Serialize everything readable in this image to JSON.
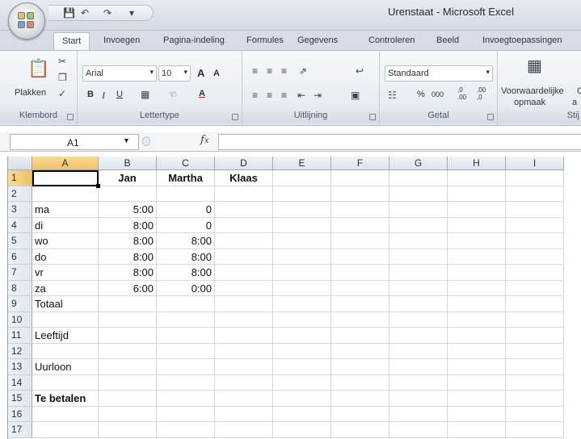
{
  "app": {
    "window_title": "Urenstaat - Microsoft Excel",
    "qat": {
      "save_icon": "save-icon",
      "undo_icon": "undo-icon",
      "redo_icon": "redo-icon",
      "customize_icon": "chevron-down-icon"
    }
  },
  "tabs": [
    "Start",
    "Invoegen",
    "Pagina-indeling",
    "Formules",
    "Gegevens",
    "Controleren",
    "Beeld",
    "Invoegtoepassingen"
  ],
  "ribbon": {
    "clipboard": {
      "paste_label": "Plakken",
      "group_label": "Klembord"
    },
    "font": {
      "font_name": "Arial",
      "font_size": "10",
      "bold": "B",
      "italic": "I",
      "underline": "U",
      "grow": "A",
      "shrink": "A",
      "font_color": "A",
      "group_label": "Lettertype"
    },
    "alignment": {
      "group_label": "Uitlijning"
    },
    "number": {
      "format": "Standaard",
      "percent": "%",
      "thousands": "000",
      "inc_dec": ",0 .00",
      "dec_dec": ",00 ,0",
      "group_label": "Getal"
    },
    "styles": {
      "cond_format_line1": "Voorwaardelijke",
      "cond_format_line2": "opmaak",
      "cut_off_1": "C",
      "cut_off_2": "a",
      "group_label": "Stij"
    }
  },
  "formula_bar": {
    "name_box": "A1",
    "fx": "fx",
    "formula": ""
  },
  "sheet": {
    "active_cell": "A1",
    "columns": [
      "A",
      "B",
      "C",
      "D",
      "E",
      "F",
      "G",
      "H",
      "I"
    ],
    "rows": [
      "1",
      "2",
      "3",
      "4",
      "5",
      "6",
      "7",
      "8",
      "9",
      "10",
      "11",
      "12",
      "13",
      "14",
      "15",
      "16",
      "17"
    ],
    "cells": {
      "B1": "Jan",
      "C1": "Martha",
      "D1": "Klaas",
      "A3": "ma",
      "B3": "5:00",
      "C3": "0",
      "A4": "di",
      "B4": "8:00",
      "C4": "0",
      "A5": "wo",
      "B5": "8:00",
      "C5": "8:00",
      "A6": "do",
      "B6": "8:00",
      "C6": "8:00",
      "A7": "vr",
      "B7": "8:00",
      "C7": "8:00",
      "A8": "za",
      "B8": "6:00",
      "C8": "0:00",
      "A9": "Totaal",
      "A11": "Leeftijd",
      "A13": "Uurloon",
      "A15": "Te betalen"
    }
  }
}
